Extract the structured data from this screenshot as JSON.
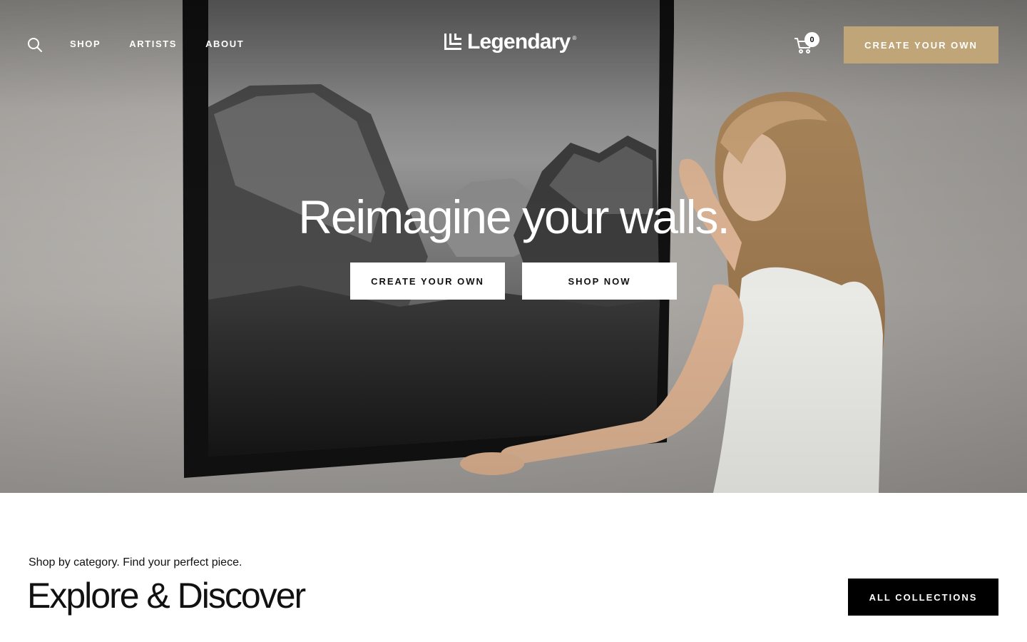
{
  "header": {
    "nav_links": [
      "SHOP",
      "ARTISTS",
      "ABOUT"
    ],
    "logo_text": "Legendary",
    "logo_mark": "®",
    "cart_count": "0",
    "cta_label": "CREATE YOUR OWN",
    "search_icon": "search-icon",
    "cart_icon": "cart-icon"
  },
  "hero": {
    "title": "Reimagine your walls.",
    "primary_button": "CREATE YOUR OWN",
    "secondary_button": "SHOP NOW",
    "image_subject": "woman hanging a black-framed black and white mountain valley photograph on a wall"
  },
  "section": {
    "eyebrow": "Shop by category. Find your perfect piece.",
    "title": "Explore & Discover",
    "button": "ALL COLLECTIONS"
  },
  "colors": {
    "accent": "#bfa578",
    "dark": "#000000",
    "text": "#111111"
  }
}
